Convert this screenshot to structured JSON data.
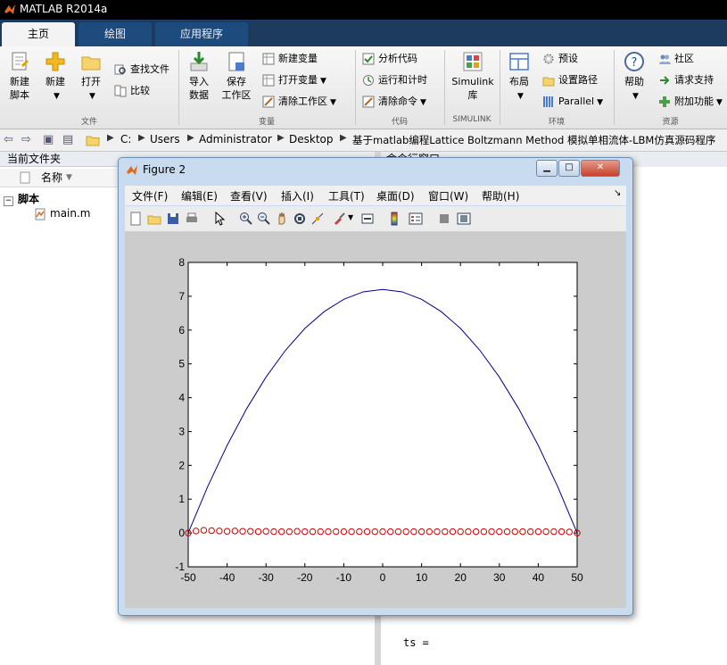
{
  "app": {
    "title": "MATLAB R2014a"
  },
  "ribbon": {
    "tabs": [
      "主页",
      "绘图",
      "应用程序"
    ],
    "file_group": {
      "label": "文件",
      "new_script": "新建\n脚本",
      "new": "新建",
      "open": "打开",
      "find_files": "查找文件",
      "compare": "比较"
    },
    "variable_group": {
      "label": "变量",
      "import_data": "导入\n数据",
      "save_workspace": "保存\n工作区",
      "new_variable": "新建变量",
      "open_variable": "打开变量",
      "clear_workspace": "清除工作区"
    },
    "code_group": {
      "label": "代码",
      "analyze_code": "分析代码",
      "run_and_time": "运行和计时",
      "clear_commands": "清除命令"
    },
    "simulink_group": {
      "label": "SIMULINK",
      "simulink_library": "Simulink\n库"
    },
    "environment_group": {
      "label": "环境",
      "layout": "布局",
      "preferences": "预设",
      "set_path": "设置路径",
      "parallel": "Parallel"
    },
    "resources_group": {
      "label": "资源",
      "help": "帮助",
      "community": "社区",
      "request_support": "请求支持",
      "addons": "附加功能"
    }
  },
  "address": {
    "crumbs": [
      "C:",
      "Users",
      "Administrator",
      "Desktop",
      "基于matlab编程Lattice Boltzmann Method 模拟单相流体-LBM仿真源码程序"
    ]
  },
  "current_folder": {
    "title": "当前文件夹",
    "column_name": "名称",
    "group": "脚本",
    "files": [
      "main.m"
    ]
  },
  "command_window": {
    "title": "命令行窗口",
    "last_line": "ts ="
  },
  "figure": {
    "title": "Figure 2",
    "menus": [
      "文件(F)",
      "编辑(E)",
      "查看(V)",
      "插入(I)",
      "工具(T)",
      "桌面(D)",
      "窗口(W)",
      "帮助(H)"
    ],
    "toolbar_icons": [
      "new-figure-icon",
      "open-icon",
      "save-icon",
      "print-icon",
      "pointer-icon",
      "zoom-in-icon",
      "zoom-out-icon",
      "pan-icon",
      "rotate-icon",
      "data-cursor-icon",
      "brush-icon",
      "link-icon",
      "colorbar-icon",
      "legend-icon",
      "hide-plot-tools-icon",
      "show-plot-tools-icon"
    ]
  },
  "chart_data": {
    "type": "line",
    "title": "",
    "xlabel": "",
    "ylabel": "",
    "xlim": [
      -50,
      50
    ],
    "ylim": [
      -1,
      8
    ],
    "xticks": [
      -50,
      -40,
      -30,
      -20,
      -10,
      0,
      10,
      20,
      30,
      40,
      50
    ],
    "yticks": [
      -1,
      0,
      1,
      2,
      3,
      4,
      5,
      6,
      7,
      8
    ],
    "grid": false,
    "series": [
      {
        "style": "line",
        "color": "#00008b",
        "x": [
          -50,
          -45,
          -40,
          -35,
          -30,
          -25,
          -20,
          -15,
          -10,
          -5,
          0,
          5,
          10,
          15,
          20,
          25,
          30,
          35,
          40,
          45,
          50
        ],
        "y": [
          0,
          1.37,
          2.59,
          3.67,
          4.61,
          5.4,
          6.05,
          6.55,
          6.91,
          7.13,
          7.2,
          7.13,
          6.91,
          6.55,
          6.05,
          5.4,
          4.61,
          3.67,
          2.59,
          1.37,
          0
        ]
      },
      {
        "style": "markers-o",
        "color": "#cc0000",
        "x": [
          -50,
          -48,
          -46,
          -44,
          -42,
          -40,
          -38,
          -36,
          -34,
          -32,
          -30,
          -28,
          -26,
          -24,
          -22,
          -20,
          -18,
          -16,
          -14,
          -12,
          -10,
          -8,
          -6,
          -4,
          -2,
          0,
          2,
          4,
          6,
          8,
          10,
          12,
          14,
          16,
          18,
          20,
          22,
          24,
          26,
          28,
          30,
          32,
          34,
          36,
          38,
          40,
          42,
          44,
          46,
          48,
          50
        ],
        "y": [
          0.0,
          0.06,
          0.08,
          0.07,
          0.06,
          0.05,
          0.06,
          0.05,
          0.05,
          0.04,
          0.05,
          0.04,
          0.04,
          0.04,
          0.05,
          0.04,
          0.04,
          0.04,
          0.04,
          0.04,
          0.04,
          0.04,
          0.04,
          0.04,
          0.04,
          0.04,
          0.04,
          0.04,
          0.04,
          0.04,
          0.04,
          0.04,
          0.04,
          0.04,
          0.04,
          0.04,
          0.04,
          0.04,
          0.04,
          0.04,
          0.04,
          0.04,
          0.04,
          0.04,
          0.04,
          0.04,
          0.04,
          0.04,
          0.04,
          0.03,
          0.0
        ]
      }
    ]
  }
}
